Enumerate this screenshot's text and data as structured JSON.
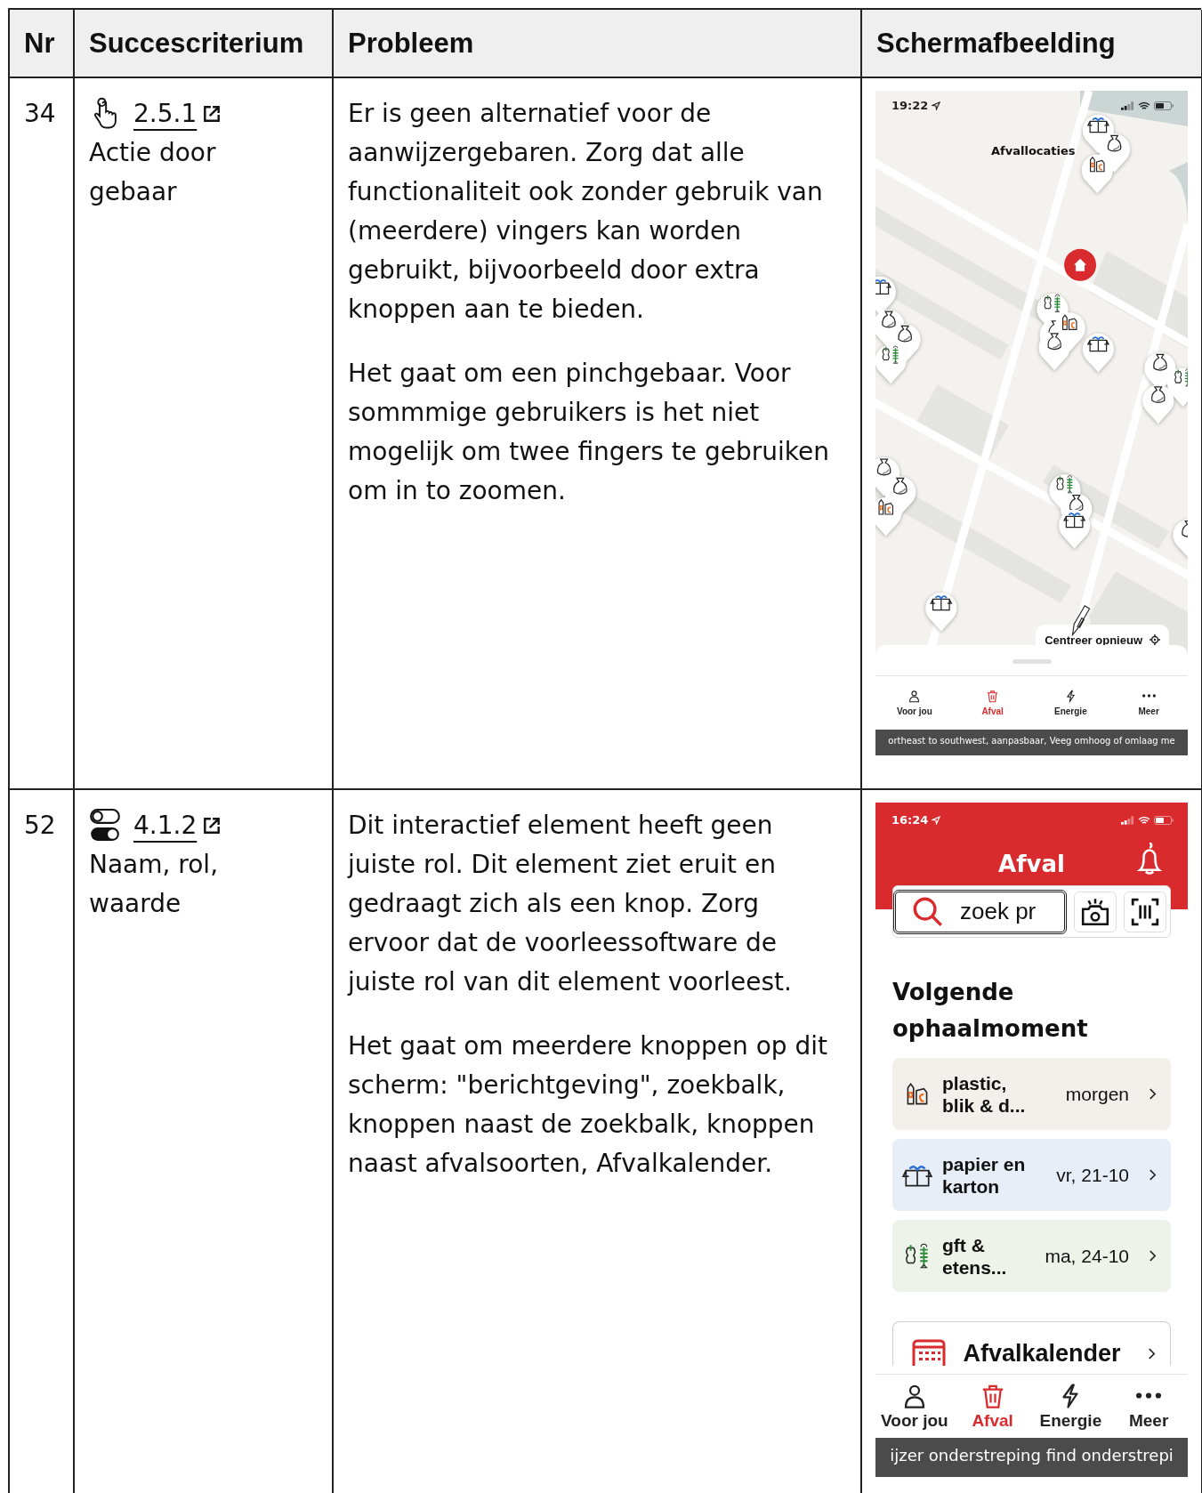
{
  "table": {
    "columns": [
      "Nr",
      "Succescriterium",
      "Probleem",
      "Schermafbeelding"
    ],
    "rows": [
      {
        "nr": "34",
        "criterion": {
          "kind": "gesture",
          "code": "2.5.1",
          "name": "Actie door gebaar"
        },
        "problem": [
          "Er is geen alternatief voor de aanwijzergebaren. Zorg dat alle functionaliteit ook zonder gebruik van (meerdere) vingers kan worden gebruikt, bijvoorbeeld door extra knoppen aan te bieden.",
          "Het gaat om een pinchgebaar. Voor sommmige gebruikers is het niet mogelijk om twee fingers te gebruiken om in to zoomen."
        ],
        "screenshot": {
          "kind": "map",
          "time": "19:22",
          "title": "Afvallocaties",
          "recenter_button": "Centreer opnieuw",
          "tabs": [
            {
              "label": "Voor jou",
              "selected": false
            },
            {
              "label": "Afval",
              "selected": true
            },
            {
              "label": "Energie",
              "selected": false
            },
            {
              "label": "Meer",
              "selected": false
            }
          ],
          "caption": "ortheast to southwest, aanpasbaar, Veeg omhoog of omlaag me"
        }
      },
      {
        "nr": "52",
        "criterion": {
          "kind": "toggle",
          "code": "4.1.2",
          "name": "Naam, rol, waarde"
        },
        "problem": [
          "Dit interactief element heeft geen juiste rol. Dit element ziet eruit en gedraagt zich als een knop. Zorg ervoor dat de voorleessoftware de juiste rol van dit element voorleest.",
          "Het gaat om meerdere knoppen op dit scherm: \"berichtgeving\", zoekbalk, knoppen naast de zoekbalk, knoppen naast afvalsoorten, Afvalkalender."
        ],
        "screenshot": {
          "kind": "overview",
          "time": "16:24",
          "title": "Afval",
          "search_placeholder": "zoek pr",
          "heading": "Volgende ophaalmoment",
          "collections": [
            {
              "kind": "plastic",
              "name": "plastic, blik & d...",
              "date": "morgen",
              "color": "#f3efea"
            },
            {
              "kind": "paper",
              "name": "papier en karton",
              "date": "vr, 21-10",
              "color": "#e8eef8"
            },
            {
              "kind": "organic",
              "name": "gft & etens...",
              "date": "ma, 24-10",
              "color": "#eef3ea"
            }
          ],
          "calendar_link": "Afvalkalender",
          "tabs": [
            {
              "label": "Voor jou",
              "selected": false
            },
            {
              "label": "Afval",
              "selected": true
            },
            {
              "label": "Energie",
              "selected": false
            },
            {
              "label": "Meer",
              "selected": false
            }
          ],
          "caption": "ijzer onderstreping find onderstrepi"
        }
      }
    ]
  }
}
